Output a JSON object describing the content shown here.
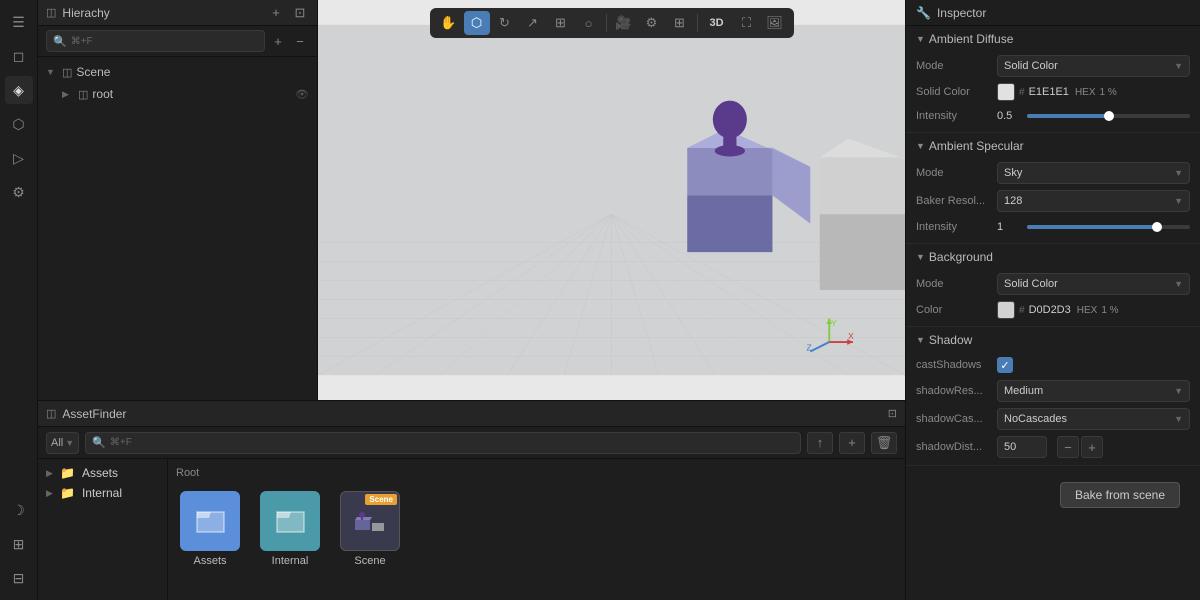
{
  "hierarchy": {
    "title": "Hierachy",
    "search_placeholder": "⌘+F",
    "scene": "Scene",
    "root": "root"
  },
  "toolbar": {
    "buttons": [
      {
        "id": "hand",
        "icon": "✋",
        "active": false
      },
      {
        "id": "select",
        "icon": "⬡",
        "active": true
      },
      {
        "id": "rotate",
        "icon": "↻",
        "active": false
      },
      {
        "id": "move",
        "icon": "↗",
        "active": false
      },
      {
        "id": "scale",
        "icon": "⊞",
        "active": false
      },
      {
        "id": "orbit",
        "icon": "○",
        "active": false
      },
      {
        "id": "camera",
        "icon": "📷",
        "active": false
      },
      {
        "id": "settings",
        "icon": "⚙",
        "active": false
      },
      {
        "id": "grid",
        "icon": "⊞",
        "active": false
      },
      {
        "id": "mode3d",
        "icon": "3D",
        "active": false
      },
      {
        "id": "maximize",
        "icon": "⛶",
        "active": false
      },
      {
        "id": "photo",
        "icon": "🖼",
        "active": false
      }
    ]
  },
  "inspector": {
    "title": "Inspector",
    "ambient_diffuse": {
      "label": "Ambient Diffuse",
      "mode_label": "Mode",
      "mode_value": "Solid Color",
      "color_label": "Solid Color",
      "color_hex": "E1E1E1",
      "color_format": "HEX",
      "color_percent": "1",
      "intensity_label": "Intensity",
      "intensity_value": "0.5",
      "intensity_percent": 50
    },
    "ambient_specular": {
      "label": "Ambient Specular",
      "mode_label": "Mode",
      "mode_value": "Sky",
      "baker_label": "Baker Resol...",
      "baker_value": "128",
      "intensity_label": "Intensity",
      "intensity_value": "1",
      "intensity_percent": 80
    },
    "background": {
      "label": "Background",
      "mode_label": "Mode",
      "mode_value": "Solid Color",
      "color_label": "Color",
      "color_hex": "D0D2D3",
      "color_format": "HEX",
      "color_percent": "1"
    },
    "shadow": {
      "label": "Shadow",
      "cast_label": "castShadows",
      "cast_checked": true,
      "res_label": "shadowRes...",
      "res_value": "Medium",
      "cas_label": "shadowCas...",
      "cas_value": "NoCascades",
      "dist_label": "shadowDist...",
      "dist_value": "50"
    },
    "bake_btn": "Bake from scene"
  },
  "asset_finder": {
    "title": "AssetFinder",
    "filter": "All",
    "search_placeholder": "⌘+F",
    "breadcrumb": "Root",
    "items": [
      {
        "label": "Assets",
        "color": "blue"
      },
      {
        "label": "Internal",
        "color": "teal"
      },
      {
        "label": "Scene",
        "color": "scene"
      }
    ],
    "tree": [
      {
        "label": "Assets",
        "indent": 0
      },
      {
        "label": "Internal",
        "indent": 0
      }
    ]
  }
}
